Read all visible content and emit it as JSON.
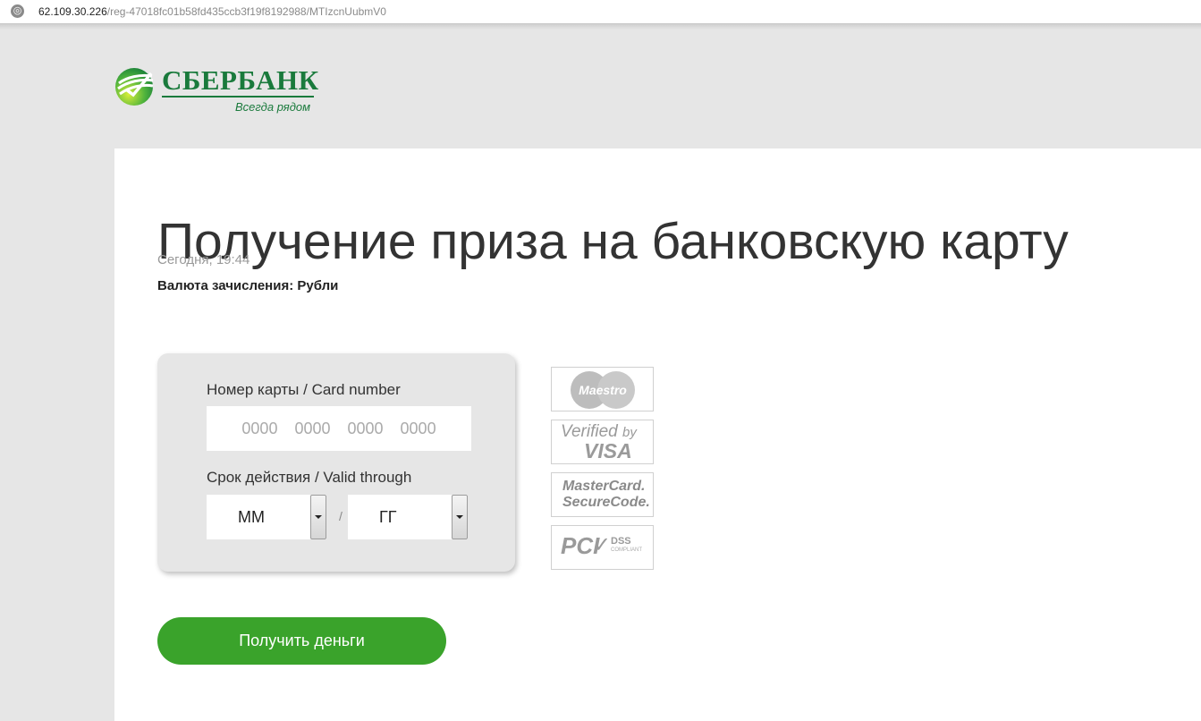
{
  "browser": {
    "address_host": "62.109.30.226",
    "address_path": "/reg-47018fc01b58fd435ccb3f19f8192988/MTIzcnUubmV0",
    "site_icon": "globe-icon"
  },
  "logo": {
    "title": "СБЕРБАНК",
    "slogan": "Всегда рядом",
    "brand_color": "#1a7a3c"
  },
  "page": {
    "title": "Получение приза на банковскую карту",
    "date": "Сегодня, 19:44",
    "currency": "Валюта зачисления: Рубли"
  },
  "form": {
    "card_label": "Номер карты / Card number",
    "card_placeholder": "0000 0000 0000 0000",
    "valid_label": "Срок действия / Valid through",
    "month_value": "ММ",
    "year_value": "ГГ",
    "separator": "/",
    "submit_label": "Получить деньги",
    "submit_color": "#3aa32b"
  },
  "badges": {
    "maestro": "Maestro",
    "vbv_line1": "Verified",
    "vbv_by": "by",
    "vbv_line2": "VISA",
    "mc_line1": "MasterCard.",
    "mc_line2": "SecureCode.",
    "pci": "PCI",
    "dss": "DSS",
    "dss_sub": "COMPLIANT"
  }
}
